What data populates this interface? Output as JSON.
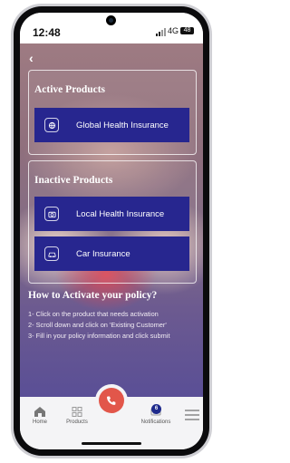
{
  "status_bar": {
    "time": "12:48",
    "network": "4G",
    "battery": "48"
  },
  "back_label": "‹",
  "active_section": {
    "title": "Active Products",
    "items": [
      {
        "label": "Global Health Insurance",
        "icon": "globe-shield-icon"
      }
    ]
  },
  "inactive_section": {
    "title": "Inactive Products",
    "items": [
      {
        "label": "Local Health Insurance",
        "icon": "camera-shield-icon"
      },
      {
        "label": "Car Insurance",
        "icon": "car-icon"
      }
    ]
  },
  "howto": {
    "title": "How to Activate your policy?",
    "steps": [
      "1- Click on the product that needs activation",
      "2- Scroll down and click on 'Existing Customer'",
      "3- Fill in your policy information and click submit"
    ]
  },
  "nav": {
    "home": "Home",
    "products": "Products",
    "notifications": "Notifications",
    "notification_count": "6"
  },
  "colors": {
    "accent": "#27268f",
    "call": "#e2564a"
  }
}
